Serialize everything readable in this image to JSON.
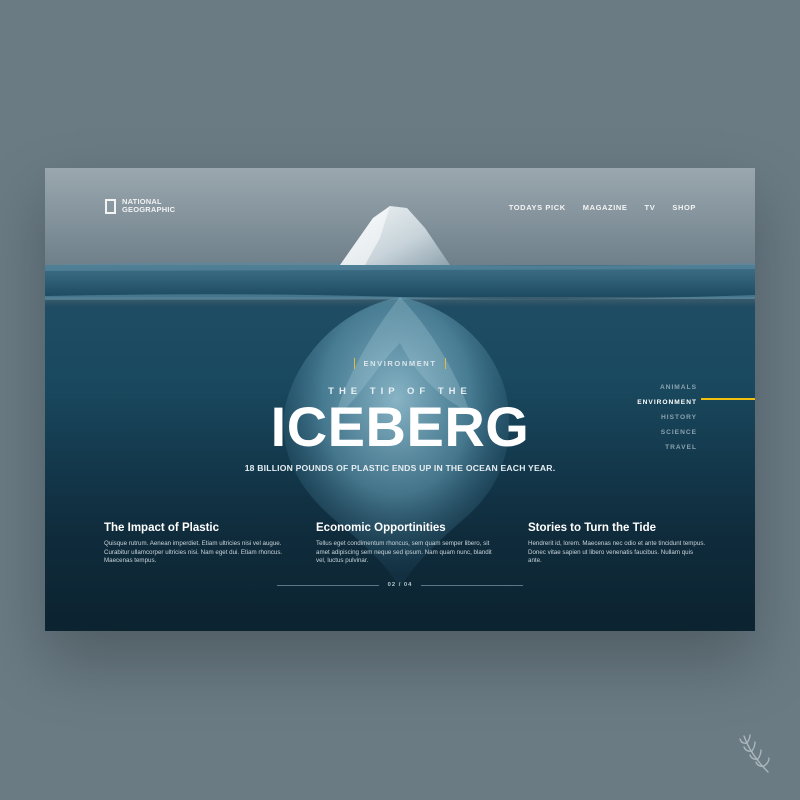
{
  "brand": {
    "name": "NATIONAL GEOGRAPHIC"
  },
  "topnav": [
    "TODAYS PICK",
    "MAGAZINE",
    "TV",
    "SHOP"
  ],
  "hero": {
    "category": "ENVIRONMENT",
    "subtitle": "THE TIP OF THE",
    "title": "ICEBERG",
    "tagline": "18 BILLION POUNDS OF PLASTIC ENDS UP IN THE OCEAN EACH YEAR."
  },
  "sidenav": {
    "items": [
      "ANIMALS",
      "ENVIRONMENT",
      "HISTORY",
      "SCIENCE",
      "TRAVEL"
    ],
    "active": "ENVIRONMENT"
  },
  "columns": [
    {
      "title": "The Impact of Plastic",
      "body": "Quisque rutrum. Aenean imperdiet. Etiam ultricies nisi vel augue. Curabitur ullamcorper ultricies nisi. Nam eget dui. Etiam rhoncus. Maecenas tempus."
    },
    {
      "title": "Economic Opportinities",
      "body": "Tellus eget condimentum rhoncus, sem quam semper libero, sit amet adipiscing sem neque sed ipsum. Nam quam nunc, blandit vel, luctus pulvinar."
    },
    {
      "title": "Stories to Turn the Tide",
      "body": "Hendrerit id, lorem. Maecenas nec odio et ante tincidunt tempus. Donec vitae sapien ut libero venenatis faucibus. Nullam quis ante."
    }
  ],
  "pager": {
    "label": "02 / 04"
  },
  "colors": {
    "accent": "#f2c10e",
    "background": "#6a7b84",
    "ocean": "#143a4e"
  },
  "icons": {
    "logo": "yellow-border-icon",
    "badge": "laurel-icon"
  }
}
